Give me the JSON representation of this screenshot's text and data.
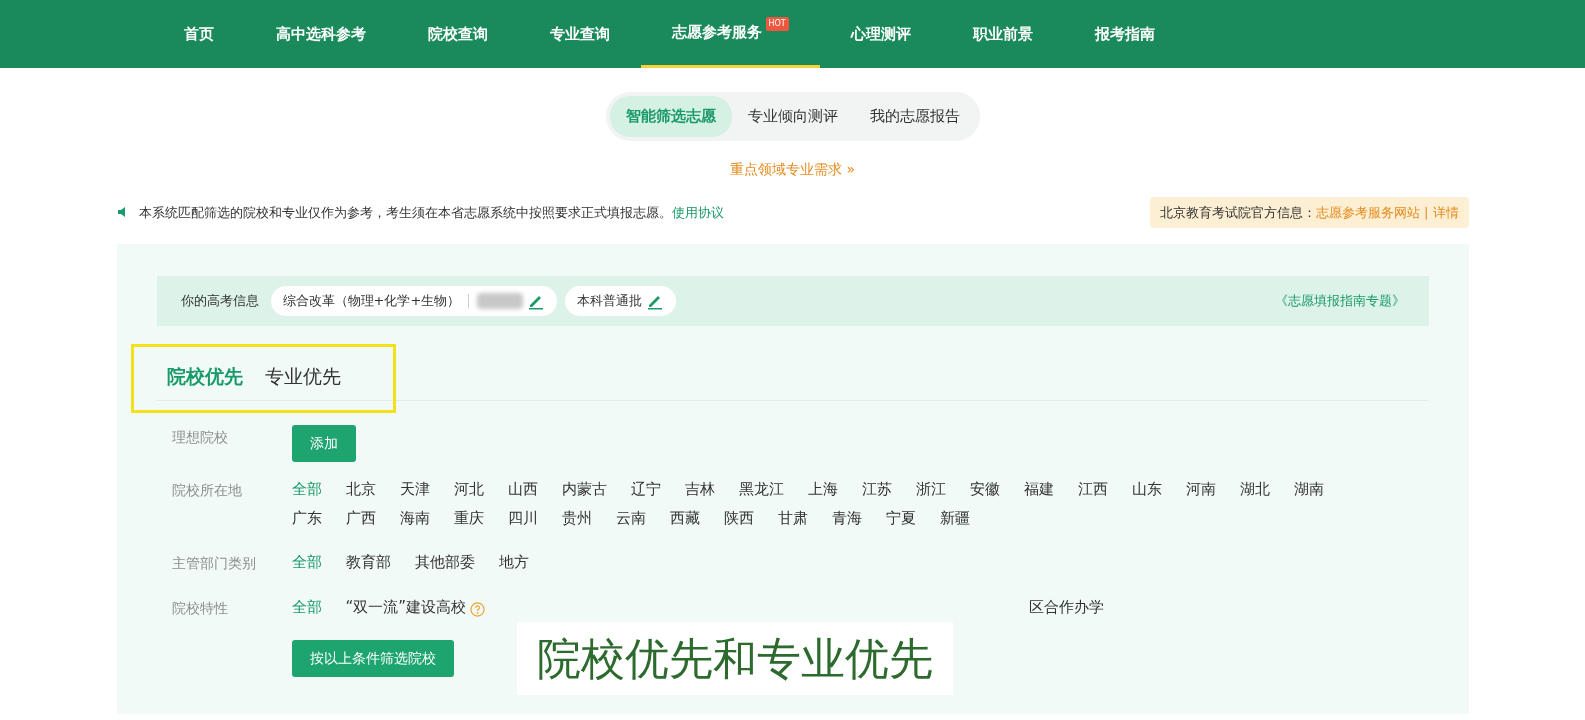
{
  "nav": [
    {
      "label": "首页",
      "selected": false
    },
    {
      "label": "高中选科参考",
      "selected": false
    },
    {
      "label": "院校查询",
      "selected": false
    },
    {
      "label": "专业查询",
      "selected": false
    },
    {
      "label": "志愿参考服务",
      "selected": true,
      "badge": "HOT"
    },
    {
      "label": "心理测评",
      "selected": false
    },
    {
      "label": "职业前景",
      "selected": false
    },
    {
      "label": "报考指南",
      "selected": false
    }
  ],
  "subtabs": [
    {
      "label": "智能筛选志愿",
      "selected": true
    },
    {
      "label": "专业倾向测评",
      "selected": false
    },
    {
      "label": "我的志愿报告",
      "selected": false
    }
  ],
  "feature_link": "重点领域专业需求 »",
  "notice": {
    "text": "本系统匹配筛选的院校和专业仅作为参考，考生须在本省志愿系统中按照要求正式填报志愿。",
    "link": "使用协议"
  },
  "official": {
    "label": "北京教育考试院官方信息：",
    "link": "志愿参考服务网站",
    "separator": "|",
    "detail": "详情"
  },
  "exam_info": {
    "label": "你的高考信息",
    "subjects": "综合改革（物理+化学+生物）",
    "score_hidden": true,
    "batch": "本科普通批",
    "guide_link": "《志愿填报指南专题》"
  },
  "mode_tabs": [
    {
      "label": "院校优先",
      "selected": true
    },
    {
      "label": "专业优先",
      "selected": false
    }
  ],
  "filters": [
    {
      "label": "理想院校",
      "kind": "button",
      "button": "添加"
    },
    {
      "label": "院校所在地",
      "kind": "options",
      "options": [
        {
          "label": "全部",
          "selected": true
        },
        {
          "label": "北京",
          "selected": false
        },
        {
          "label": "天津",
          "selected": false
        },
        {
          "label": "河北",
          "selected": false
        },
        {
          "label": "山西",
          "selected": false
        },
        {
          "label": "内蒙古",
          "selected": false
        },
        {
          "label": "辽宁",
          "selected": false
        },
        {
          "label": "吉林",
          "selected": false
        },
        {
          "label": "黑龙江",
          "selected": false
        },
        {
          "label": "上海",
          "selected": false
        },
        {
          "label": "江苏",
          "selected": false
        },
        {
          "label": "浙江",
          "selected": false
        },
        {
          "label": "安徽",
          "selected": false
        },
        {
          "label": "福建",
          "selected": false
        },
        {
          "label": "江西",
          "selected": false
        },
        {
          "label": "山东",
          "selected": false
        },
        {
          "label": "河南",
          "selected": false
        },
        {
          "label": "湖北",
          "selected": false
        },
        {
          "label": "湖南",
          "selected": false
        },
        {
          "label": "广东",
          "selected": false
        },
        {
          "label": "广西",
          "selected": false
        },
        {
          "label": "海南",
          "selected": false
        },
        {
          "label": "重庆",
          "selected": false
        },
        {
          "label": "四川",
          "selected": false
        },
        {
          "label": "贵州",
          "selected": false
        },
        {
          "label": "云南",
          "selected": false
        },
        {
          "label": "西藏",
          "selected": false
        },
        {
          "label": "陕西",
          "selected": false
        },
        {
          "label": "甘肃",
          "selected": false
        },
        {
          "label": "青海",
          "selected": false
        },
        {
          "label": "宁夏",
          "selected": false
        },
        {
          "label": "新疆",
          "selected": false
        }
      ]
    },
    {
      "label": "主管部门类别",
      "kind": "options",
      "options": [
        {
          "label": "全部",
          "selected": true
        },
        {
          "label": "教育部",
          "selected": false
        },
        {
          "label": "其他部委",
          "selected": false
        },
        {
          "label": "地方",
          "selected": false
        }
      ]
    },
    {
      "label": "院校特性",
      "kind": "options",
      "options": [
        {
          "label": "全部",
          "selected": true,
          "help": false
        },
        {
          "label": "“双一流”建设高校",
          "selected": false,
          "help": true
        },
        {
          "label": "区合作办学",
          "selected": false,
          "help": false
        }
      ]
    }
  ],
  "submit": "按以上条件筛选院校",
  "caption": "院校优先和专业优先"
}
